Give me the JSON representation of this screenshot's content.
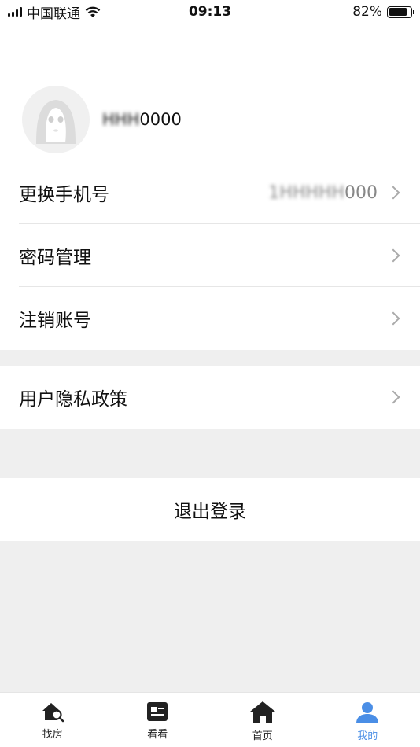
{
  "status_bar": {
    "carrier": "中国联通",
    "time": "09:13",
    "battery_percent": "82%",
    "battery_level": 0.82
  },
  "profile": {
    "name_hidden": "ΗΗΗ",
    "name_suffix": "0000"
  },
  "settings": {
    "change_phone_label": "更换手机号",
    "phone_value_hidden": "1ΗΗΗΗΗ",
    "phone_value_suffix": "000",
    "password_label": "密码管理",
    "deactivate_label": "注销账号",
    "privacy_label": "用户隐私政策"
  },
  "logout_label": "退出登录",
  "tabs": [
    {
      "label": "找房",
      "icon": "house-search-icon",
      "active": false
    },
    {
      "label": "看看",
      "icon": "news-icon",
      "active": false
    },
    {
      "label": "首页",
      "icon": "home-icon",
      "active": false
    },
    {
      "label": "我的",
      "icon": "person-icon",
      "active": true
    }
  ],
  "colors": {
    "accent": "#4a8ee6",
    "background_gray": "#efefef"
  }
}
